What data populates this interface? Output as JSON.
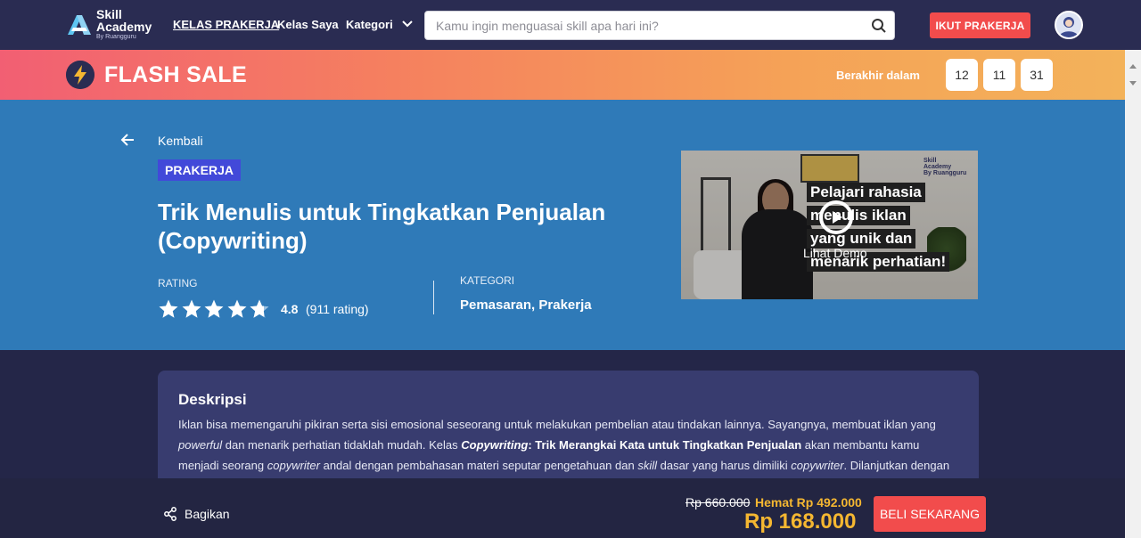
{
  "nav": {
    "logo": {
      "line1": "Skill",
      "line2": "Academy",
      "line3": "By Ruangguru"
    },
    "links": [
      {
        "label": "KELAS PRAKERJA",
        "active": true
      },
      {
        "label": "Kelas Saya",
        "active": false
      },
      {
        "label": "Kategori",
        "active": false
      }
    ],
    "search_placeholder": "Kamu ingin menguasai skill apa hari ini?",
    "cta_label": "IKUT PRAKERJA"
  },
  "flash_sale": {
    "title": "FLASH SALE",
    "ends_label": "Berakhir dalam",
    "countdown": [
      "12",
      "11",
      "31"
    ]
  },
  "hero": {
    "back_label": "Kembali",
    "badge": "PRAKERJA",
    "title": "Trik Menulis untuk Tingkatkan Penjualan (Copywriting)",
    "rating_label": "RATING",
    "rating_value": "4.8",
    "rating_stars": 4.8,
    "rating_count": "(911 rating)",
    "category_label": "KATEGORI",
    "category_value": "Pemasaran, Prakerja",
    "video": {
      "lines": [
        "Pelajari rahasia",
        "menulis iklan",
        "yang unik dan",
        "menarik perhatian!"
      ],
      "brand": [
        "Skill",
        "Academy",
        "By Ruangguru"
      ],
      "demo_label": "Lihat Demo"
    }
  },
  "description": {
    "title": "Deskripsi",
    "p1": "Iklan bisa memengaruhi pikiran serta sisi emosional seseorang untuk melakukan pembelian atau tindakan lainnya. Sayangnya, membuat iklan yang ",
    "p1_em": "powerful",
    "p2": " dan menarik perhatian tidaklah mudah. Kelas ",
    "p2_strong_em": "Copywriting",
    "p2_strong": ": Trik Merangkai Kata untuk Tingkatkan Penjualan",
    "p3": " akan membantu kamu menjadi seorang ",
    "p3_em": "copywriter",
    "p4": " andal dengan pembahasan materi seputar pengetahuan dan ",
    "p4_em": "skill",
    "p5": " dasar yang harus dimiliki ",
    "p5_em": "copywriter",
    "p6": ". Dilanjutkan dengan membahas tahapan"
  },
  "bottom": {
    "share_label": "Bagikan",
    "old_price": "Rp 660.000",
    "save_label": "Hemat Rp 492.000",
    "price": "Rp 168.000",
    "buy_label": "BELI SEKARANG"
  },
  "colors": {
    "nav_bg": "#2a2c52",
    "hero_bg": "#2f7ab8",
    "accent_red": "#f24c4c",
    "price_yellow": "#f5b731",
    "badge_blue": "#4249d9"
  }
}
